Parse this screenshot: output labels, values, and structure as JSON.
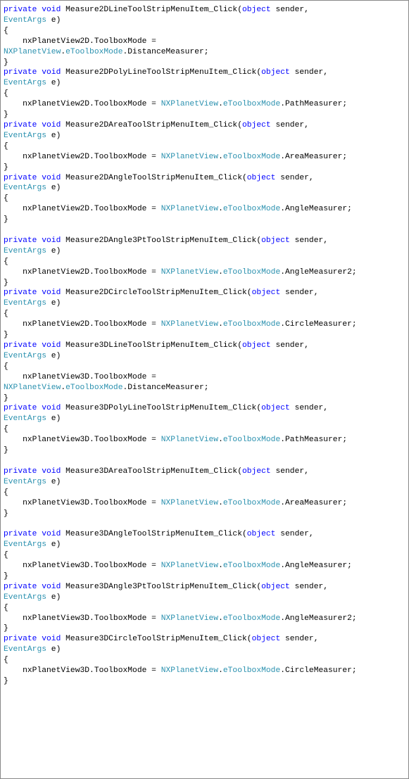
{
  "tokens": {
    "kw_private": "private",
    "kw_void": "void",
    "kw_object": "object",
    "typ_EventArgs": "EventArgs",
    "typ_NXPlanetView": "NXPlanetView",
    "typ_eToolboxMode": "eToolboxMode"
  },
  "functions": [
    {
      "name": "Measure2DLineToolStripMenuItem_Click",
      "view": "nxPlanetView2D",
      "mode": "DistanceMeasurer",
      "wrap_assign": true,
      "blank_before": false
    },
    {
      "name": "Measure2DPolyLineToolStripMenuItem_Click",
      "view": "nxPlanetView2D",
      "mode": "PathMeasurer",
      "wrap_assign": false,
      "blank_before": false
    },
    {
      "name": "Measure2DAreaToolStripMenuItem_Click",
      "view": "nxPlanetView2D",
      "mode": "AreaMeasurer",
      "wrap_assign": false,
      "blank_before": false
    },
    {
      "name": "Measure2DAngleToolStripMenuItem_Click",
      "view": "nxPlanetView2D",
      "mode": "AngleMeasurer",
      "wrap_assign": false,
      "blank_before": false
    },
    {
      "name": "Measure2DAngle3PtToolStripMenuItem_Click",
      "view": "nxPlanetView2D",
      "mode": "AngleMeasurer2",
      "wrap_assign": false,
      "blank_before": true
    },
    {
      "name": "Measure2DCircleToolStripMenuItem_Click",
      "view": "nxPlanetView2D",
      "mode": "CircleMeasurer",
      "wrap_assign": false,
      "blank_before": false
    },
    {
      "name": "Measure3DLineToolStripMenuItem_Click",
      "view": "nxPlanetView3D",
      "mode": "DistanceMeasurer",
      "wrap_assign": true,
      "blank_before": false
    },
    {
      "name": "Measure3DPolyLineToolStripMenuItem_Click",
      "view": "nxPlanetView3D",
      "mode": "PathMeasurer",
      "wrap_assign": false,
      "blank_before": false
    },
    {
      "name": "Measure3DAreaToolStripMenuItem_Click",
      "view": "nxPlanetView3D",
      "mode": "AreaMeasurer",
      "wrap_assign": false,
      "blank_before": true
    },
    {
      "name": "Measure3DAngleToolStripMenuItem_Click",
      "view": "nxPlanetView3D",
      "mode": "AngleMeasurer",
      "wrap_assign": false,
      "blank_before": true
    },
    {
      "name": "Measure3DAngle3PtToolStripMenuItem_Click",
      "view": "nxPlanetView3D",
      "mode": "AngleMeasurer2",
      "wrap_assign": false,
      "blank_before": false
    },
    {
      "name": "Measure3DCircleToolStripMenuItem_Click",
      "view": "nxPlanetView3D",
      "mode": "CircleMeasurer",
      "wrap_assign": false,
      "blank_before": false
    }
  ]
}
